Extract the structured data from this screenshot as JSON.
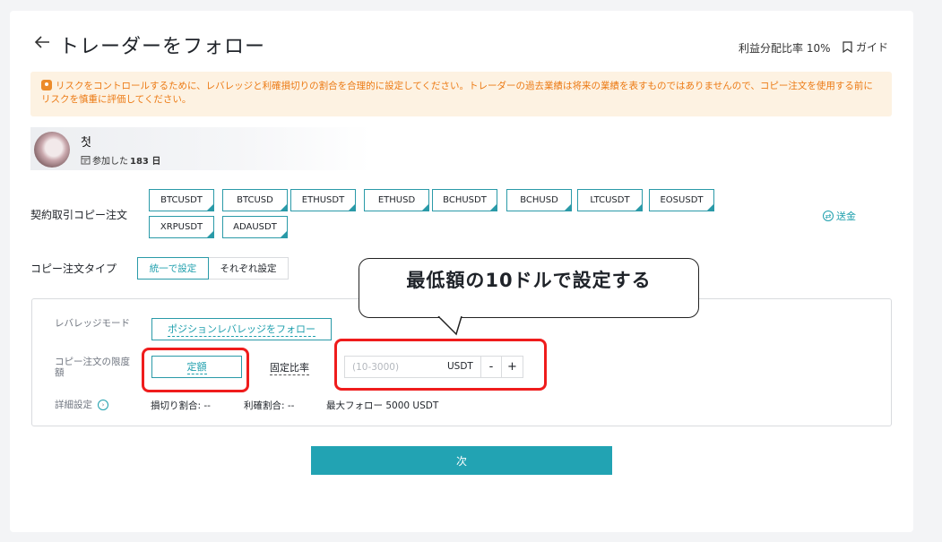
{
  "header": {
    "title": "トレーダーをフォロー",
    "profit_share": "利益分配比率 10%",
    "guide_label": "ガイド"
  },
  "warning": {
    "text": "リスクをコントロールするために、レバレッジと利確損切りの割合を合理的に設定してください。トレーダーの過去業績は将来の業績を表すものではありませんので、コピー注文を使用する前にリスクを慎重に評価してください。"
  },
  "trader": {
    "name": "첫",
    "joined_prefix": "参加した",
    "joined_days": "183 日"
  },
  "contract_copy": {
    "label": "契約取引コピー注文",
    "pairs": [
      "BTCUSDT",
      "BTCUSD",
      "ETHUSDT",
      "ETHUSD",
      "BCHUSDT",
      "BCHUSD",
      "LTCUSDT",
      "EOSUSDT",
      "XRPUSDT",
      "ADAUSDT"
    ],
    "send_label": "送金"
  },
  "copy_type": {
    "label": "コピー注文タイプ",
    "options": [
      "統一で設定",
      "それぞれ設定"
    ],
    "selected": "統一で設定"
  },
  "settings": {
    "leverage_label": "レバレッジモード",
    "leverage_value": "ポジションレバレッジをフォロー",
    "limit_label": "コピー注文の限度額",
    "limit_fixed": "定額",
    "limit_ratio": "固定比率",
    "amount_placeholder": "(10-3000)",
    "amount_value": "",
    "amount_unit": "USDT",
    "minus": "-",
    "plus": "+",
    "detail_label": "詳細設定",
    "stop_loss": "損切り割合: --",
    "take_profit": "利確割合: --",
    "max_follow": "最大フォロー 5000 USDT"
  },
  "next_label": "次",
  "annotation": {
    "bubble_text": "最低額の10ドルで設定する"
  },
  "colors": {
    "accent": "#22a3b3",
    "warning_bg": "#fdf2e2",
    "warning_text": "#ec7a14",
    "highlight_red": "#ef1c1c"
  }
}
